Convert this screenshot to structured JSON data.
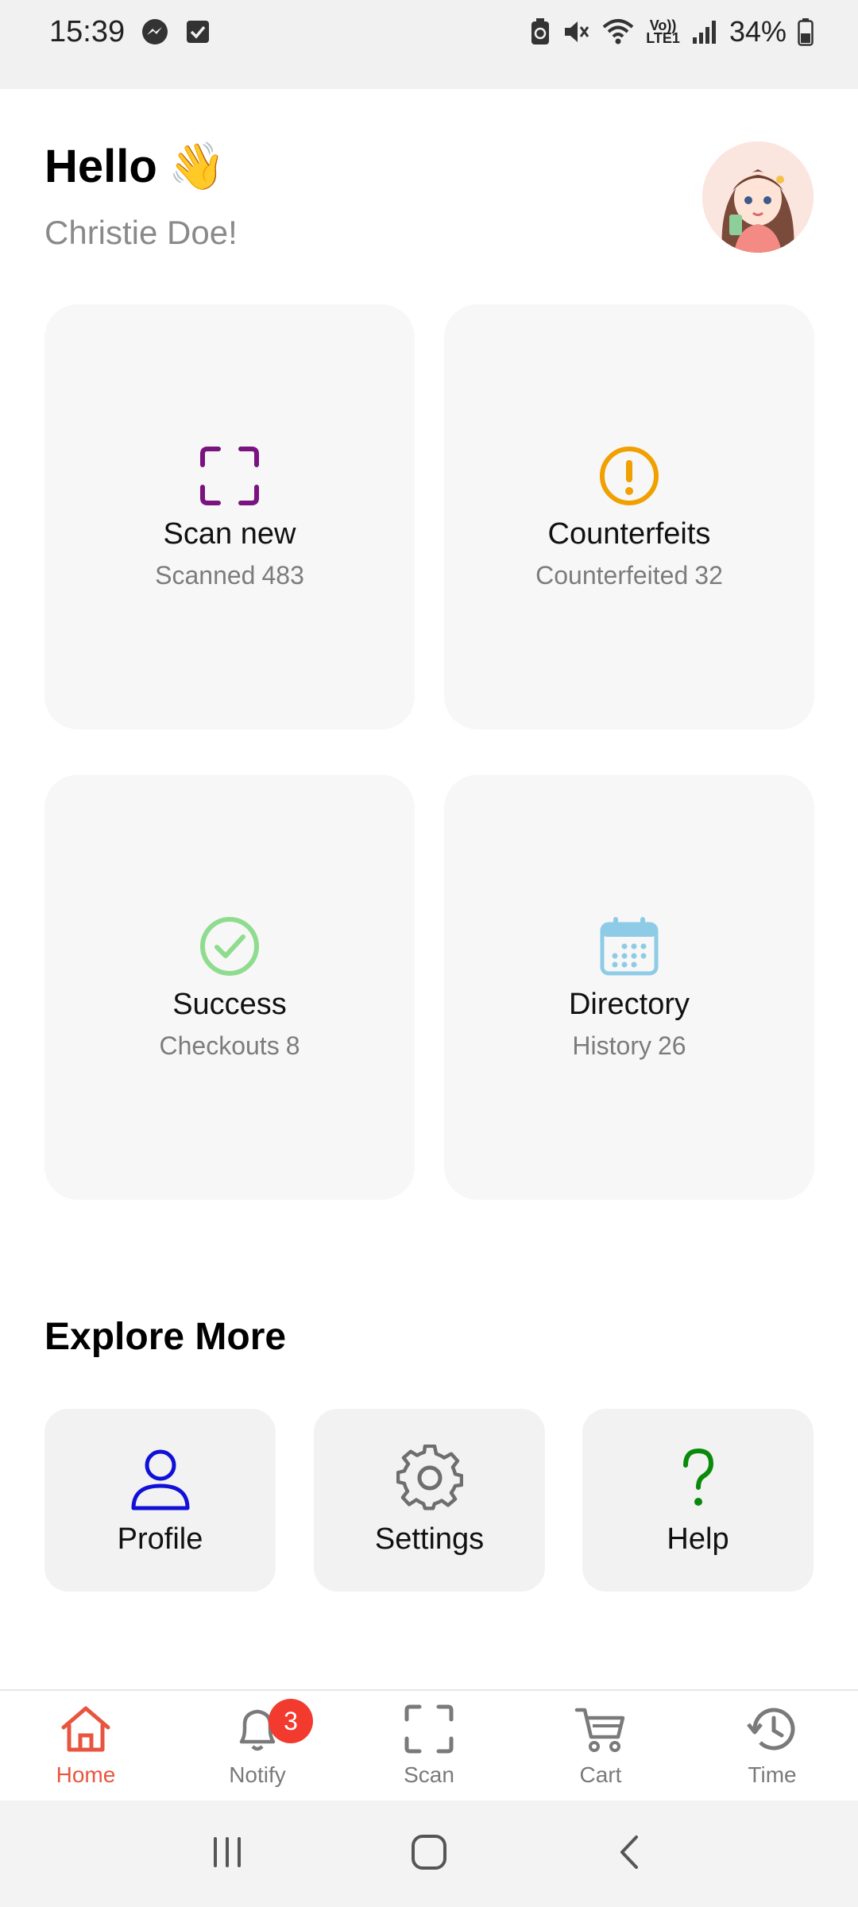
{
  "status_bar": {
    "time": "15:39",
    "volte_top": "Vo))",
    "volte_bottom": "LTE1",
    "battery": "34%",
    "icons": [
      "messenger-icon",
      "checkbox-icon",
      "battery-saver-icon",
      "mute-icon",
      "wifi-icon",
      "signal-icon",
      "battery-icon"
    ]
  },
  "header": {
    "hello": "Hello",
    "wave": "👋",
    "name": "Christie Doe!"
  },
  "tiles": [
    {
      "title": "Scan new",
      "sub_label": "Scanned",
      "count": "483",
      "icon": "scan-frame-icon",
      "color": "#7a1280"
    },
    {
      "title": "Counterfeits",
      "sub_label": "Counterfeited",
      "count": "32",
      "icon": "alert-circle-icon",
      "color": "#f0a000"
    },
    {
      "title": "Success",
      "sub_label": "Checkouts",
      "count": "8",
      "icon": "check-circle-icon",
      "color": "#8fdc8f"
    },
    {
      "title": "Directory",
      "sub_label": "History",
      "count": "26",
      "icon": "calendar-icon",
      "color": "#8ecbe6"
    }
  ],
  "explore": {
    "title": "Explore More",
    "items": [
      {
        "label": "Profile",
        "icon": "user-icon",
        "color": "#1010d8"
      },
      {
        "label": "Settings",
        "icon": "gear-icon",
        "color": "#6e6e6e"
      },
      {
        "label": "Help",
        "icon": "question-icon",
        "color": "#0a8a0a"
      }
    ]
  },
  "bottom_nav": {
    "items": [
      {
        "label": "Home",
        "icon": "home-icon",
        "active": true
      },
      {
        "label": "Notify",
        "icon": "bell-icon",
        "badge": "3"
      },
      {
        "label": "Scan",
        "icon": "scan-frame-icon"
      },
      {
        "label": "Cart",
        "icon": "cart-icon"
      },
      {
        "label": "Time",
        "icon": "history-icon"
      }
    ],
    "active_color": "#e8553f"
  },
  "system_nav": [
    "recents-icon",
    "home-circle-icon",
    "back-icon"
  ]
}
